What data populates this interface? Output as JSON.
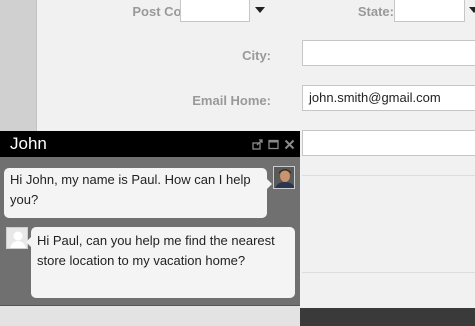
{
  "form": {
    "post_code_label": "Post Code:",
    "state_label": "State:",
    "city_label": "City:",
    "city_value": "",
    "email_home_label": "Email Home:",
    "email_home_value": "john.smith@gmail.com"
  },
  "chat": {
    "title": "John",
    "icons": [
      "popout-icon",
      "maximize-icon",
      "close-icon"
    ],
    "messages": [
      {
        "from": "John",
        "text": "Hi John, my name is Paul. How can I help you?"
      },
      {
        "from": "visitor",
        "text": "Hi Paul, can you help me find the nearest store location to my vacation home?"
      }
    ]
  }
}
